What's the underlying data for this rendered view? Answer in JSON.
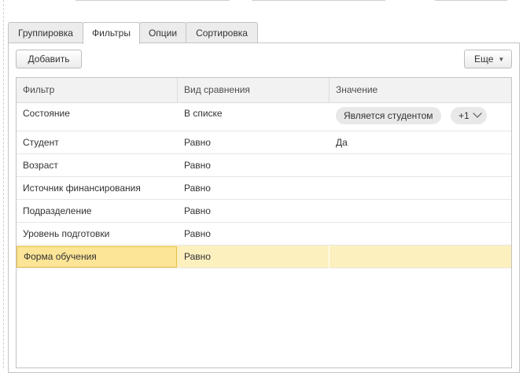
{
  "tabs": [
    {
      "label": "Группировка",
      "active": false
    },
    {
      "label": "Фильтры",
      "active": true
    },
    {
      "label": "Опции",
      "active": false
    },
    {
      "label": "Сортировка",
      "active": false
    }
  ],
  "toolbar": {
    "add_label": "Добавить",
    "more_label": "Еще"
  },
  "grid": {
    "columns": [
      "Фильтр",
      "Вид сравнения",
      "Значение"
    ],
    "rows": [
      {
        "filter": "Состояние",
        "comparison": "В списке",
        "value": "",
        "chips": [
          "Является студентом",
          "+1"
        ]
      },
      {
        "filter": "Студент",
        "comparison": "Равно",
        "value": "Да"
      },
      {
        "filter": "Возраст",
        "comparison": "Равно",
        "value": ""
      },
      {
        "filter": "Источник финансирования",
        "comparison": "Равно",
        "value": ""
      },
      {
        "filter": "Подразделение",
        "comparison": "Равно",
        "value": ""
      },
      {
        "filter": "Уровень подготовки",
        "comparison": "Равно",
        "value": ""
      },
      {
        "filter": "Форма обучения",
        "comparison": "Равно",
        "value": "",
        "selected": true
      }
    ]
  },
  "colors": {
    "selected_row": "#fdf0bf",
    "selected_cell": "#fce596",
    "selected_border": "#e6c24a"
  }
}
